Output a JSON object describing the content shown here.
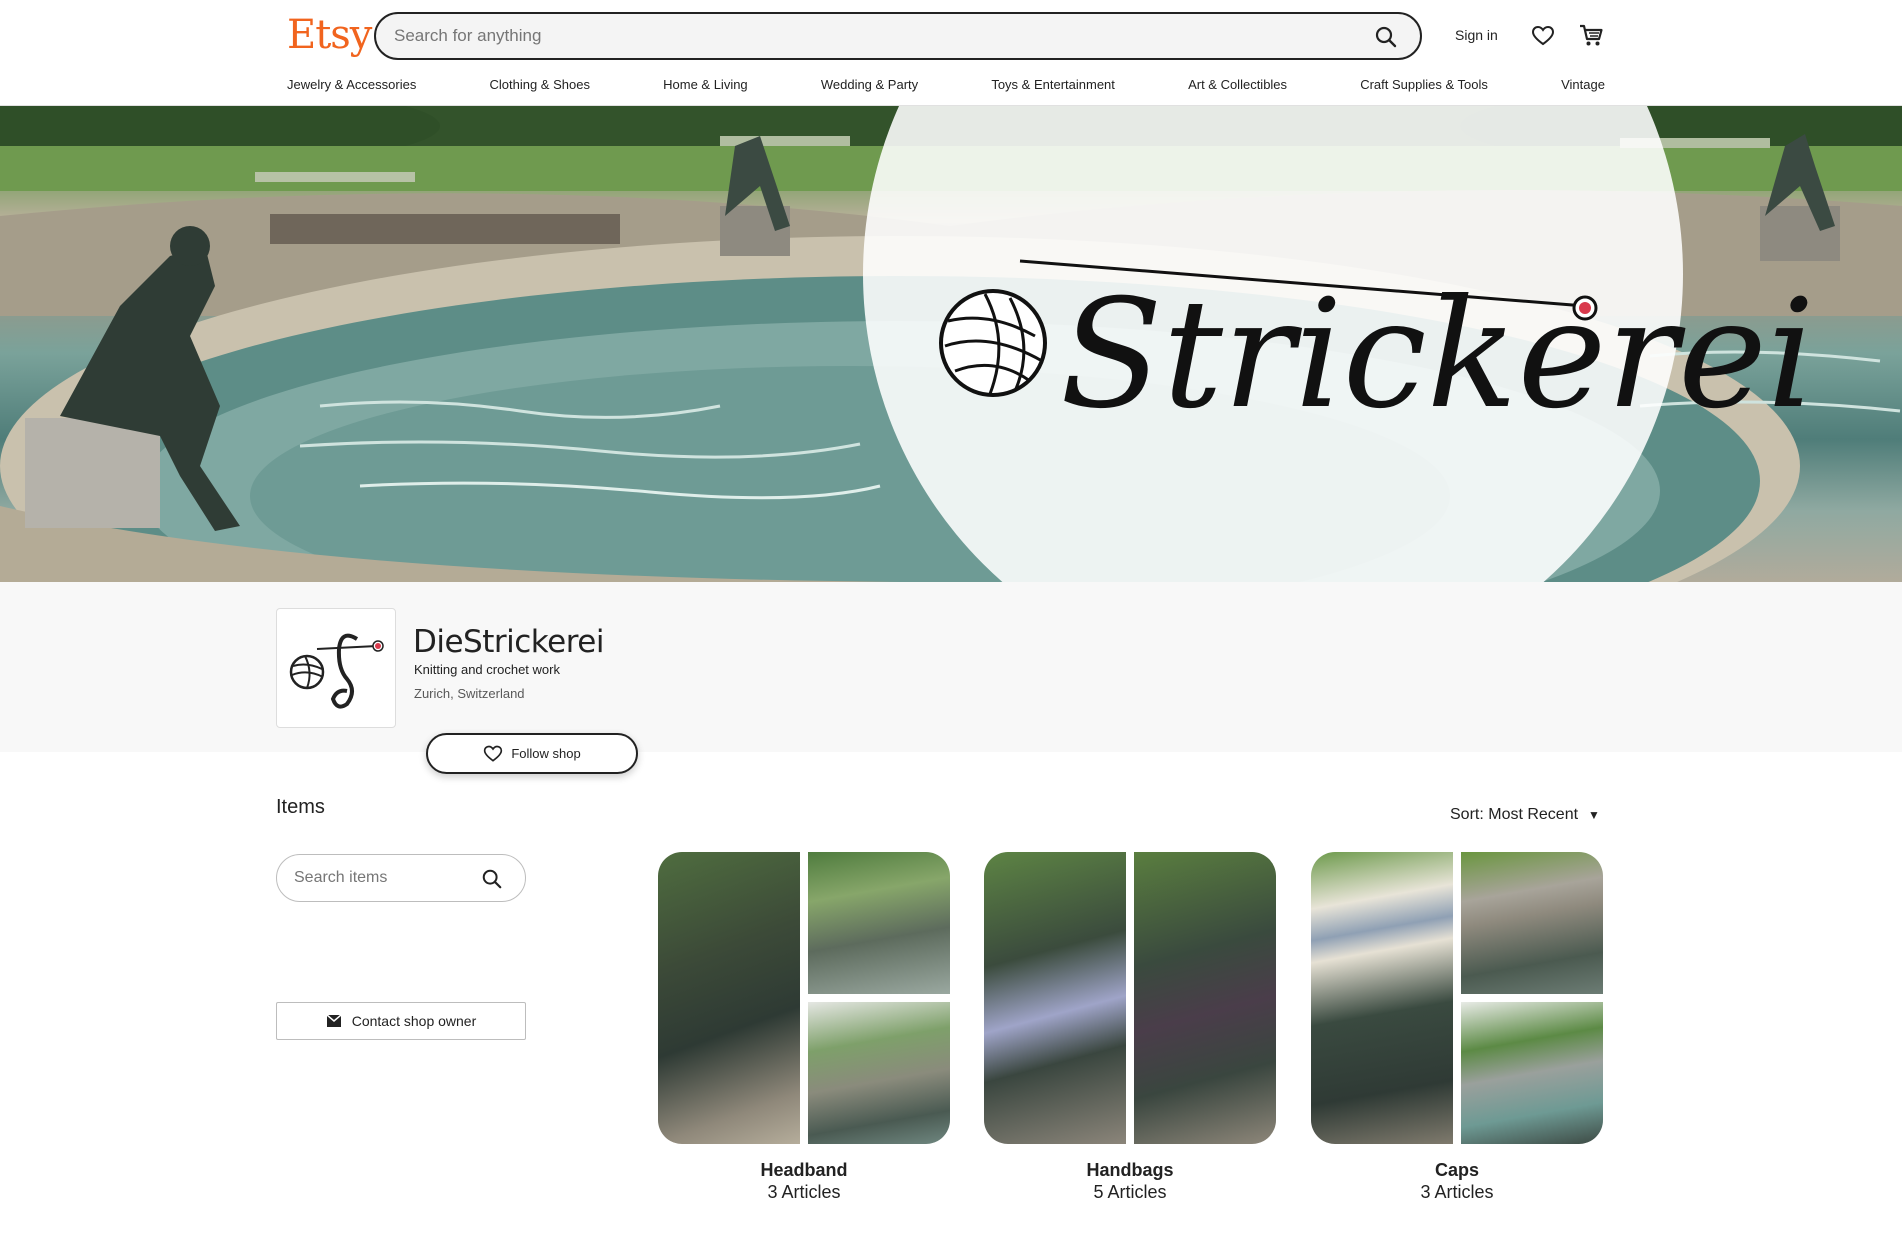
{
  "header": {
    "logo": "Etsy",
    "search_placeholder": "Search for anything",
    "sign_in": "Sign in",
    "icons": [
      "search-icon",
      "heart-icon",
      "cart-icon"
    ],
    "categories": [
      "Jewelry & Accessories",
      "Clothing & Shoes",
      "Home & Living",
      "Wedding & Party",
      "Toys & Entertainment",
      "Art & Collectibles",
      "Craft Supplies & Tools",
      "Vintage"
    ]
  },
  "banner": {
    "logo_text": "Strickerei"
  },
  "shop": {
    "name": "DieStrickerei",
    "tagline": "Knitting and crochet work",
    "location": "Zurich, Switzerland",
    "follow_label": "Follow shop"
  },
  "items": {
    "title": "Items",
    "sort_label": "Sort: Most Recent",
    "search_placeholder": "Search items",
    "contact_label": "Contact shop owner",
    "sections": [
      {
        "name": "Headband",
        "count": "3 Articles"
      },
      {
        "name": "Handbags",
        "count": "5 Articles"
      },
      {
        "name": "Caps",
        "count": "3 Articles"
      }
    ]
  },
  "colors": {
    "brand": "#f1641e",
    "text": "#222222",
    "band": "#f8f8f8"
  }
}
